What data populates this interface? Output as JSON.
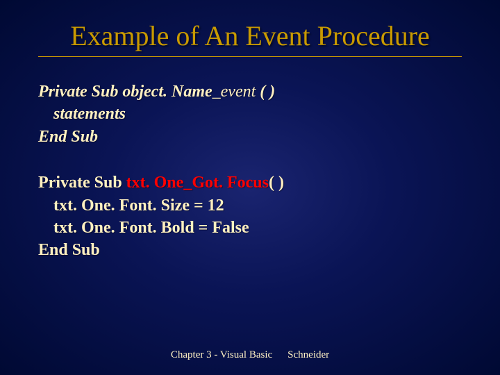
{
  "title": "Example of An Event Procedure",
  "syntax": {
    "line1_prefix": "Private Sub ",
    "line1_obj": "object. Name",
    "line1_evt": "_event",
    "line1_suffix": " ( )",
    "line2": "statements",
    "line3": "End Sub"
  },
  "example": {
    "line1_prefix": "Private Sub ",
    "line1_name": "txt. One_Got. Focus",
    "line1_suffix": "( )",
    "line2": "txt. One. Font. Size = 12",
    "line3": "txt. One. Font. Bold = False",
    "line4": "End Sub"
  },
  "footer": {
    "left": "Chapter 3 - Visual Basic",
    "right": "Schneider"
  }
}
